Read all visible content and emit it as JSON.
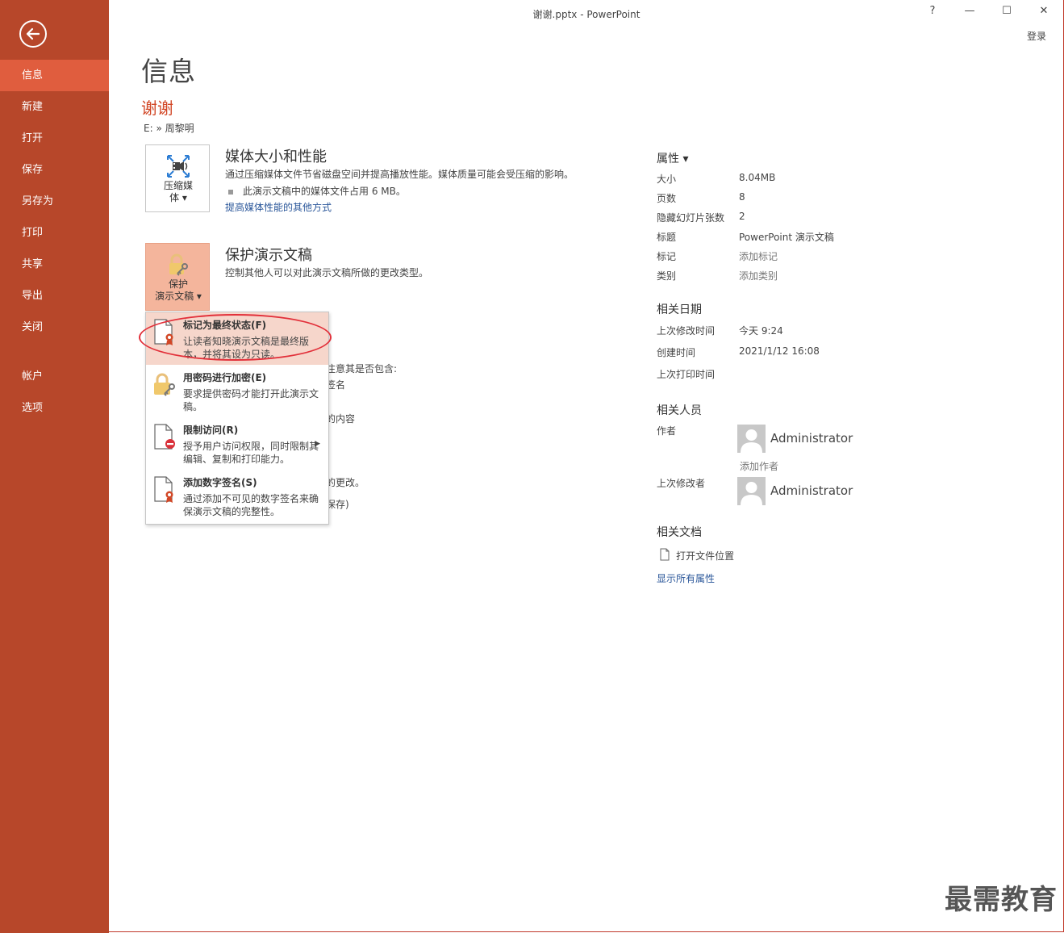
{
  "window": {
    "title": "谢谢.pptx - PowerPoint",
    "help": "?",
    "minimize": "—",
    "maximize": "☐",
    "close": "✕",
    "login": "登录"
  },
  "sidebar": {
    "items": [
      {
        "label": "信息"
      },
      {
        "label": "新建"
      },
      {
        "label": "打开"
      },
      {
        "label": "保存"
      },
      {
        "label": "另存为"
      },
      {
        "label": "打印"
      },
      {
        "label": "共享"
      },
      {
        "label": "导出"
      },
      {
        "label": "关闭"
      },
      {
        "label": "帐户"
      },
      {
        "label": "选项"
      }
    ]
  },
  "main": {
    "title": "信息",
    "doc_name": "谢谢",
    "doc_path": "E: » 周黎明",
    "media": {
      "button_label_1": "压缩媒",
      "button_label_2": "体 ▾",
      "heading": "媒体大小和性能",
      "desc": "通过压缩媒体文件节省磁盘空间并提高播放性能。媒体质量可能会受压缩的影响。",
      "bullet": "此演示文稿中的媒体文件占用 6 MB。",
      "link": "提高媒体性能的其他方式"
    },
    "protect": {
      "button_label_1": "保护",
      "button_label_2": "演示文稿 ▾",
      "heading": "保护演示文稿",
      "desc": "控制其他人可以对此演示文稿所做的更改类型。"
    },
    "behind_text": {
      "t1": "注意其是否包含:",
      "t2": "签名",
      "t3": "的内容",
      "t4": "的更改。",
      "t5": "保存)"
    }
  },
  "dropdown": {
    "items": [
      {
        "title": "标记为最终状态(F)",
        "desc": "让读者知晓演示文稿是最终版本，并将其设为只读。"
      },
      {
        "title": "用密码进行加密(E)",
        "desc": "要求提供密码才能打开此演示文稿。"
      },
      {
        "title": "限制访问(R)",
        "desc": "授予用户访问权限，同时限制其编辑、复制和打印能力。"
      },
      {
        "title": "添加数字签名(S)",
        "desc": "通过添加不可见的数字签名来确保演示文稿的完整性。"
      }
    ]
  },
  "properties": {
    "heading": "属性 ▾",
    "rows": [
      {
        "label": "大小",
        "value": "8.04MB"
      },
      {
        "label": "页数",
        "value": "8"
      },
      {
        "label": "隐藏幻灯片张数",
        "value": "2"
      },
      {
        "label": "标题",
        "value": "PowerPoint 演示文稿"
      },
      {
        "label": "标记",
        "value": "添加标记"
      },
      {
        "label": "类别",
        "value": "添加类别"
      }
    ]
  },
  "dates": {
    "heading": "相关日期",
    "rows": [
      {
        "label": "上次修改时间",
        "value": "今天 9:24"
      },
      {
        "label": "创建时间",
        "value": "2021/1/12 16:08"
      },
      {
        "label": "上次打印时间",
        "value": ""
      }
    ]
  },
  "people": {
    "heading": "相关人员",
    "author_label": "作者",
    "author_name": "Administrator",
    "add_author": "添加作者",
    "modifier_label": "上次修改者",
    "modifier_name": "Administrator"
  },
  "related_docs": {
    "heading": "相关文档",
    "open_location": "打开文件位置",
    "show_all": "显示所有属性"
  },
  "watermark": "最需教育"
}
